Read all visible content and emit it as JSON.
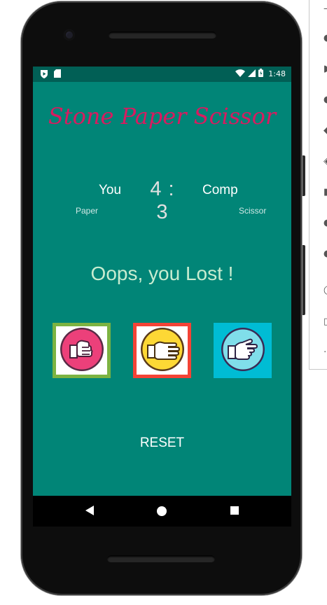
{
  "status_bar": {
    "time": "1:48",
    "icons": [
      "play-protect-icon",
      "sd-card-icon",
      "wifi-icon",
      "signal-icon",
      "battery-icon"
    ]
  },
  "app": {
    "title": "Stone Paper Scissor",
    "title_color": "#d81b60",
    "background": "#018577"
  },
  "scoreboard": {
    "player_label": "You",
    "score": "4 : 3",
    "computer_label": "Comp",
    "player_choice": "Paper",
    "computer_choice": "Scissor"
  },
  "result_text": "Oops, you Lost !",
  "choices": [
    {
      "name": "stone",
      "icon": "stone-hand-icon",
      "bg": "#e91e63",
      "border": "#7cb342"
    },
    {
      "name": "paper",
      "icon": "paper-hand-icon",
      "bg": "#fdd835",
      "border": "#f44336"
    },
    {
      "name": "scissor",
      "icon": "scissor-hand-icon",
      "bg": "#80deea",
      "border": "#00bcd4"
    }
  ],
  "reset_label": "RESET",
  "nav": {
    "icons": [
      "back-icon",
      "home-icon",
      "recents-icon"
    ]
  }
}
